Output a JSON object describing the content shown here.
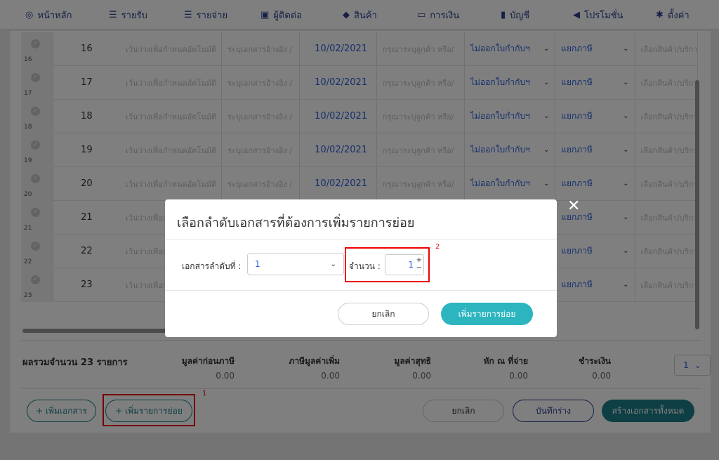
{
  "nav": [
    {
      "icon": "home-icon",
      "glyph": "◎",
      "label": "หน้าหลัก"
    },
    {
      "icon": "income-icon",
      "glyph": "☰",
      "label": "รายรับ"
    },
    {
      "icon": "expense-icon",
      "glyph": "☰",
      "label": "รายจ่าย"
    },
    {
      "icon": "contacts-icon",
      "glyph": "▣",
      "label": "ผู้ติดต่อ"
    },
    {
      "icon": "product-icon",
      "glyph": "◆",
      "label": "สินค้า"
    },
    {
      "icon": "finance-icon",
      "glyph": "▭",
      "label": "การเงิน"
    },
    {
      "icon": "account-icon",
      "glyph": "▮",
      "label": "บัญชี"
    },
    {
      "icon": "promotion-icon",
      "glyph": "◀",
      "label": "โปรโมชั่น"
    },
    {
      "icon": "settings-icon",
      "glyph": "✱",
      "label": "ตั้งค่า"
    }
  ],
  "rows": [
    {
      "index": "16",
      "num": "16",
      "desc": "เว้นว่างเพื่อกำหนดอัตโนมัติ",
      "ref": "ระบุเอกสารอ้างอิง /",
      "date": "10/02/2021",
      "contact": "กรุณาระบุลูกค้า หรือ/",
      "tax_invoice": "ไม่ออกใบกำกับฯ",
      "vat": "แยกภาษี",
      "product": "เลือกสินค้า/บริการ"
    },
    {
      "index": "17",
      "num": "17",
      "desc": "เว้นว่างเพื่อกำหนดอัตโนมัติ",
      "ref": "ระบุเอกสารอ้างอิง /",
      "date": "10/02/2021",
      "contact": "กรุณาระบุลูกค้า หรือ/",
      "tax_invoice": "ไม่ออกใบกำกับฯ",
      "vat": "แยกภาษี",
      "product": "เลือกสินค้า/บริการ"
    },
    {
      "index": "18",
      "num": "18",
      "desc": "เว้นว่างเพื่อกำหนดอัตโนมัติ",
      "ref": "ระบุเอกสารอ้างอิง /",
      "date": "10/02/2021",
      "contact": "กรุณาระบุลูกค้า หรือ/",
      "tax_invoice": "ไม่ออกใบกำกับฯ",
      "vat": "แยกภาษี",
      "product": "เลือกสินค้า/บริการ"
    },
    {
      "index": "19",
      "num": "19",
      "desc": "เว้นว่างเพื่อกำหนดอัตโนมัติ",
      "ref": "ระบุเอกสารอ้างอิง /",
      "date": "10/02/2021",
      "contact": "กรุณาระบุลูกค้า หรือ/",
      "tax_invoice": "ไม่ออกใบกำกับฯ",
      "vat": "แยกภาษี",
      "product": "เลือกสินค้า/บริการ"
    },
    {
      "index": "20",
      "num": "20",
      "desc": "เว้นว่างเพื่อกำหนดอัตโนมัติ",
      "ref": "ระบุเอกสารอ้างอิง /",
      "date": "10/02/2021",
      "contact": "กรุณาระบุลูกค้า หรือ/",
      "tax_invoice": "ไม่ออกใบกำกับฯ",
      "vat": "แยกภาษี",
      "product": "เลือกสินค้า/บริการ"
    },
    {
      "index": "21",
      "num": "21",
      "desc": "เว้นว่างเพื่อกำหนดอัตโนมัติ",
      "ref": "",
      "date": "",
      "contact": "",
      "tax_invoice": "",
      "vat": "แยกภาษี",
      "product": "เลือกสินค้า/บริการ"
    },
    {
      "index": "22",
      "num": "22",
      "desc": "เว้นว่างเพื่อกำหนดอัตโนมัติ",
      "ref": "",
      "date": "",
      "contact": "",
      "tax_invoice": "",
      "vat": "แยกภาษี",
      "product": "เลือกสินค้า/บริการ"
    },
    {
      "index": "23",
      "num": "23",
      "desc": "เว้นว่างเพื่อกำหนดอัตโนมัติ",
      "ref": "",
      "date": "",
      "contact": "",
      "tax_invoice": "",
      "vat": "แยกภาษี",
      "product": "เลือกสินค้า/บริการ"
    }
  ],
  "summary": {
    "title": "ผลรวมจำนวน 23 รายการ",
    "pre_tax_label": "มูลค่าก่อนภาษี",
    "pre_tax_value": "0.00",
    "vat_label": "ภาษีมูลค่าเพิ่ม",
    "vat_value": "0.00",
    "net_label": "มูลค่าสุทธิ",
    "net_value": "0.00",
    "wht_label": "หัก ณ ที่จ่าย",
    "wht_value": "0.00",
    "pay_label": "ชำระเงิน",
    "pay_value": "0.00",
    "page_select": "1"
  },
  "bottom": {
    "add_doc": "+ เพิ่มเอกสาร",
    "add_item": "+ เพิ่มรายการย่อย",
    "cancel": "ยกเลิก",
    "save_draft": "บันทึกร่าง",
    "create_all": "สร้างเอกสารทั้งหมด"
  },
  "annotations": {
    "label1": "1",
    "label2": "2"
  },
  "modal": {
    "title": "เลือกลำดับเอกสารที่ต้องการเพิ่มรายการย่อย",
    "doc_label": "เอกสารลำดับที่ :",
    "doc_value": "1",
    "qty_label": "จำนวน :",
    "qty_value": "1",
    "cancel": "ยกเลิก",
    "add": "เพิ่มรายการย่อย",
    "close": "✕"
  },
  "colors": {
    "primary": "#2b3f8f",
    "teal": "#1c7f8a",
    "accent": "#2cb5bf",
    "link": "#2b5fd9",
    "annotation": "#ee0000"
  }
}
